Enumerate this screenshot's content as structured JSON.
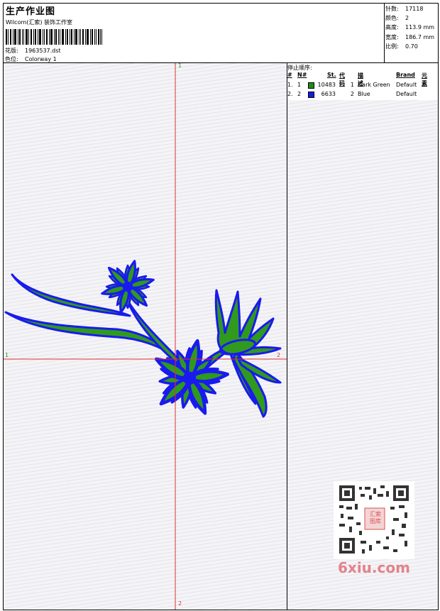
{
  "header": {
    "title": "生产作业图",
    "company": "Wilcom(汇索) 装饰工作室",
    "design_label": "花版:",
    "design_value": "1963537.dst",
    "colorway_label": "色位:",
    "colorway_value": "Colorway 1"
  },
  "stats": [
    {
      "label": "针数:",
      "value": "17118"
    },
    {
      "label": "颜色:",
      "value": "2"
    },
    {
      "label": "高度:",
      "value": "113.9 mm"
    },
    {
      "label": "宽度:",
      "value": "186.7 mm"
    },
    {
      "label": "比例:",
      "value": "0.70"
    }
  ],
  "stop_sequence": {
    "title": "停止顺序:",
    "headers": [
      "#",
      "N#",
      "St.",
      "代码",
      "描述",
      "Brand",
      "元素"
    ],
    "rows": [
      {
        "idx": "1.",
        "n": "1",
        "stitches": "10483",
        "code": "1",
        "desc": "Dark Green",
        "brand": "Default",
        "color": "#1a8f1a"
      },
      {
        "idx": "2.",
        "n": "2",
        "stitches": "6633",
        "code": "2",
        "desc": "Blue",
        "brand": "Default",
        "color": "#1020e0"
      }
    ]
  },
  "axes": {
    "v_top": "1",
    "v_bottom": "2",
    "h_left": "1",
    "h_right": "2",
    "line_color": "#e03030"
  },
  "embroidery": {
    "fill_color": "#2f9a1e",
    "outline_color": "#1a1aee"
  },
  "watermark": {
    "text": "6xiu.com",
    "seal_text": "汇索图库"
  }
}
